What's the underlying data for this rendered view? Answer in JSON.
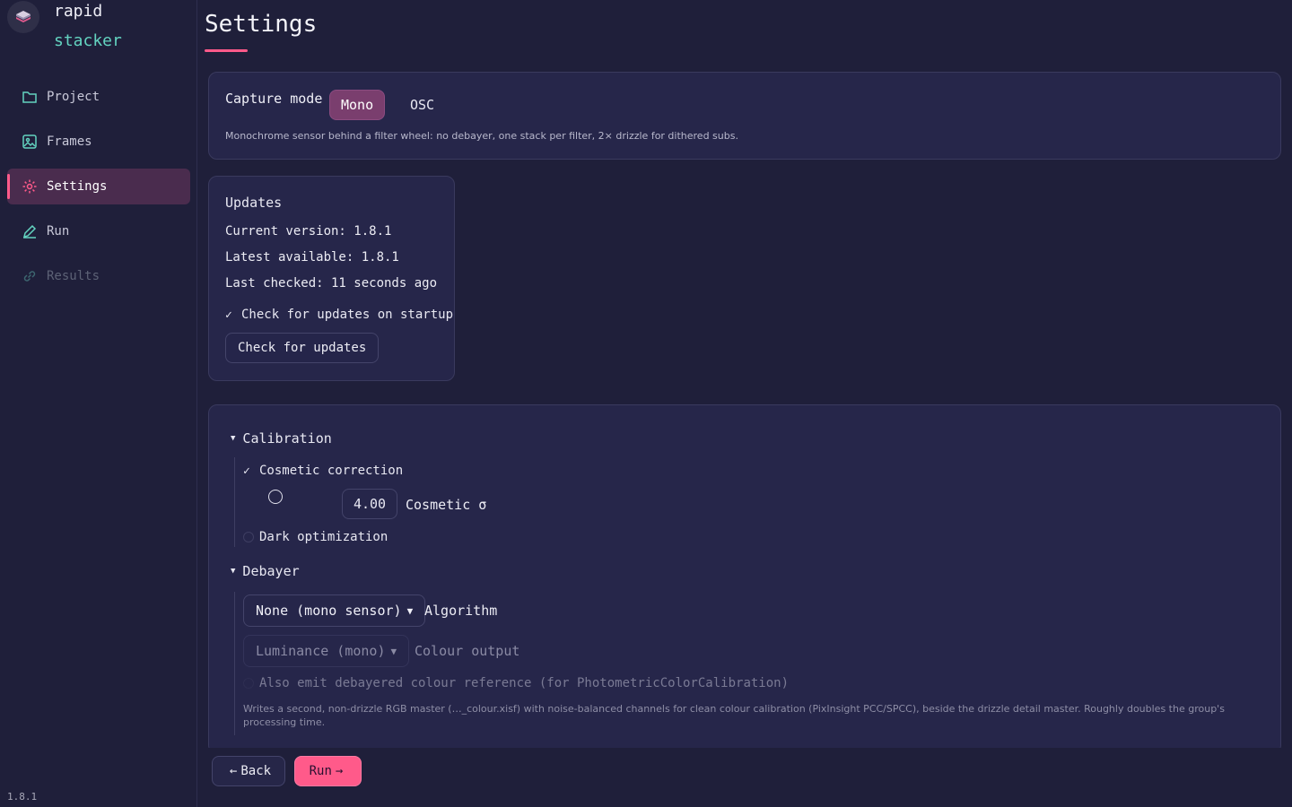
{
  "brand": {
    "line1": "rapid",
    "line2": "stacker"
  },
  "nav": [
    {
      "label": "Project",
      "icon": "folder-icon"
    },
    {
      "label": "Frames",
      "icon": "image-icon"
    },
    {
      "label": "Settings",
      "icon": "gear-icon",
      "active": true
    },
    {
      "label": "Run",
      "icon": "pencil-icon"
    },
    {
      "label": "Results",
      "icon": "link-icon",
      "disabled": true
    }
  ],
  "footer_version": "1.8.1",
  "page": {
    "title": "Settings"
  },
  "capture": {
    "label": "Capture mode",
    "options": [
      "Mono",
      "OSC"
    ],
    "selected": "Mono",
    "description": "Monochrome sensor behind a filter wheel: no debayer, one stack per filter, 2× drizzle for dithered subs."
  },
  "updates": {
    "title": "Updates",
    "current": "Current version: 1.8.1",
    "latest": "Latest available: 1.8.1",
    "checked": "Last checked: 11 seconds ago",
    "startup_label": "Check for updates on startup",
    "startup_checked": true,
    "button": "Check for updates"
  },
  "calibration": {
    "title": "Calibration",
    "cosmetic_label": "Cosmetic correction",
    "cosmetic_checked": true,
    "sigma_value": "4.00",
    "sigma_label": "Cosmetic σ",
    "dark_label": "Dark optimization",
    "dark_checked": false
  },
  "debayer": {
    "title": "Debayer",
    "algorithm_value": "None (mono sensor)",
    "algorithm_label": "Algorithm",
    "colour_value": "Luminance (mono)",
    "colour_label": "Colour output",
    "emit_label": "Also emit debayered colour reference (for PhotometricColorCalibration)",
    "emit_desc": "Writes a second, non-drizzle RGB master (…_colour.xisf) with noise-balanced channels for clean colour calibration (PixInsight PCC/SPCC), beside the drizzle detail master. Roughly doubles the group's processing time."
  },
  "actions": {
    "back": "Back",
    "run": "Run"
  },
  "colors": {
    "accent": "#ff5a8a",
    "teal": "#63d3c0",
    "bg": "#1f1f3a",
    "card": "#26264a"
  }
}
